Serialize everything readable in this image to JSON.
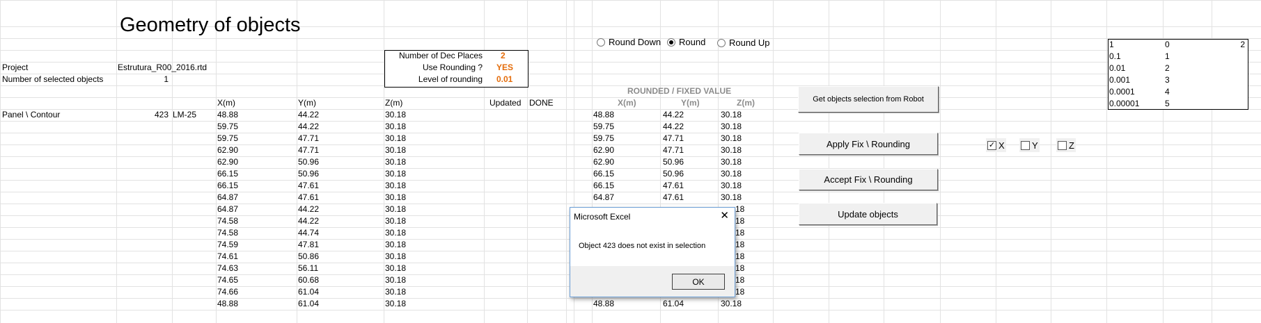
{
  "sheet": {
    "title": "Geometry of objects",
    "project_label": "Project",
    "project_value": "Estrutura_R00_2016.rtd",
    "selected_label": "Number of selected objects",
    "selected_value": "1",
    "panel_label": "Panel \\ Contour",
    "panel_id": "423",
    "panel_type": "LM-25"
  },
  "settings": {
    "dec_places_label": "Number of Dec Places",
    "dec_places_value": "2",
    "use_rounding_label": "Use Rounding ?",
    "use_rounding_value": "YES",
    "level_label": "Level of rounding",
    "level_value": "0.01"
  },
  "radios": [
    {
      "label": "Round Down",
      "checked": false
    },
    {
      "label": "Round",
      "checked": true
    },
    {
      "label": "Round Up",
      "checked": false
    }
  ],
  "table": {
    "headers": {
      "x": "X(m)",
      "y": "Y(m)",
      "z": "Z(m)",
      "updated": "Updated",
      "status": "DONE"
    },
    "rows": [
      [
        "48.88",
        "44.22",
        "30.18"
      ],
      [
        "59.75",
        "44.22",
        "30.18"
      ],
      [
        "59.75",
        "47.71",
        "30.18"
      ],
      [
        "62.90",
        "47.71",
        "30.18"
      ],
      [
        "62.90",
        "50.96",
        "30.18"
      ],
      [
        "66.15",
        "50.96",
        "30.18"
      ],
      [
        "66.15",
        "47.61",
        "30.18"
      ],
      [
        "64.87",
        "47.61",
        "30.18"
      ],
      [
        "64.87",
        "44.22",
        "30.18"
      ],
      [
        "74.58",
        "44.22",
        "30.18"
      ],
      [
        "74.58",
        "44.74",
        "30.18"
      ],
      [
        "74.59",
        "47.81",
        "30.18"
      ],
      [
        "74.61",
        "50.86",
        "30.18"
      ],
      [
        "74.63",
        "56.11",
        "30.18"
      ],
      [
        "74.65",
        "60.68",
        "30.18"
      ],
      [
        "74.66",
        "61.04",
        "30.18"
      ],
      [
        "48.88",
        "61.04",
        "30.18"
      ]
    ]
  },
  "rounded": {
    "heading": "ROUNDED / FIXED VALUE",
    "headers": {
      "x": "X(m)",
      "y": "Y(m)",
      "z": "Z(m)"
    },
    "rows": [
      [
        "48.88",
        "44.22",
        "30.18"
      ],
      [
        "59.75",
        "44.22",
        "30.18"
      ],
      [
        "59.75",
        "47.71",
        "30.18"
      ],
      [
        "62.90",
        "47.71",
        "30.18"
      ],
      [
        "62.90",
        "50.96",
        "30.18"
      ],
      [
        "66.15",
        "50.96",
        "30.18"
      ],
      [
        "66.15",
        "47.61",
        "30.18"
      ],
      [
        "64.87",
        "47.61",
        "30.18"
      ],
      [
        "",
        "",
        "18"
      ],
      [
        "",
        "",
        "18"
      ],
      [
        "",
        "",
        "18"
      ],
      [
        "",
        "",
        "18"
      ],
      [
        "",
        "",
        "18"
      ],
      [
        "",
        "",
        "18"
      ],
      [
        "",
        "",
        "18"
      ],
      [
        "",
        "",
        "18"
      ],
      [
        "48.88",
        "61.04",
        "30.18"
      ]
    ]
  },
  "buttons": {
    "get_selection": "Get objects selection from Robot",
    "apply_fix": "Apply Fix \\ Rounding",
    "accept_fix": "Accept Fix \\ Rounding",
    "update_objects": "Update objects"
  },
  "checkboxes": [
    {
      "label": "X",
      "checked": true
    },
    {
      "label": "Y",
      "checked": false
    },
    {
      "label": "Z",
      "checked": false
    }
  ],
  "lookup": {
    "header_right": "2",
    "rows": [
      [
        "1",
        "0"
      ],
      [
        "0.1",
        "1"
      ],
      [
        "0.01",
        "2"
      ],
      [
        "0.001",
        "3"
      ],
      [
        "0.0001",
        "4"
      ],
      [
        "0.00001",
        "5"
      ]
    ]
  },
  "dialog": {
    "title": "Microsoft Excel",
    "message": "Object  423 does not exist in selection",
    "ok_label": "OK"
  },
  "colors": {
    "accent_value": "#e46c0a",
    "heading_gray": "#8c8c8c",
    "dialog_border": "#6b9ed6"
  }
}
